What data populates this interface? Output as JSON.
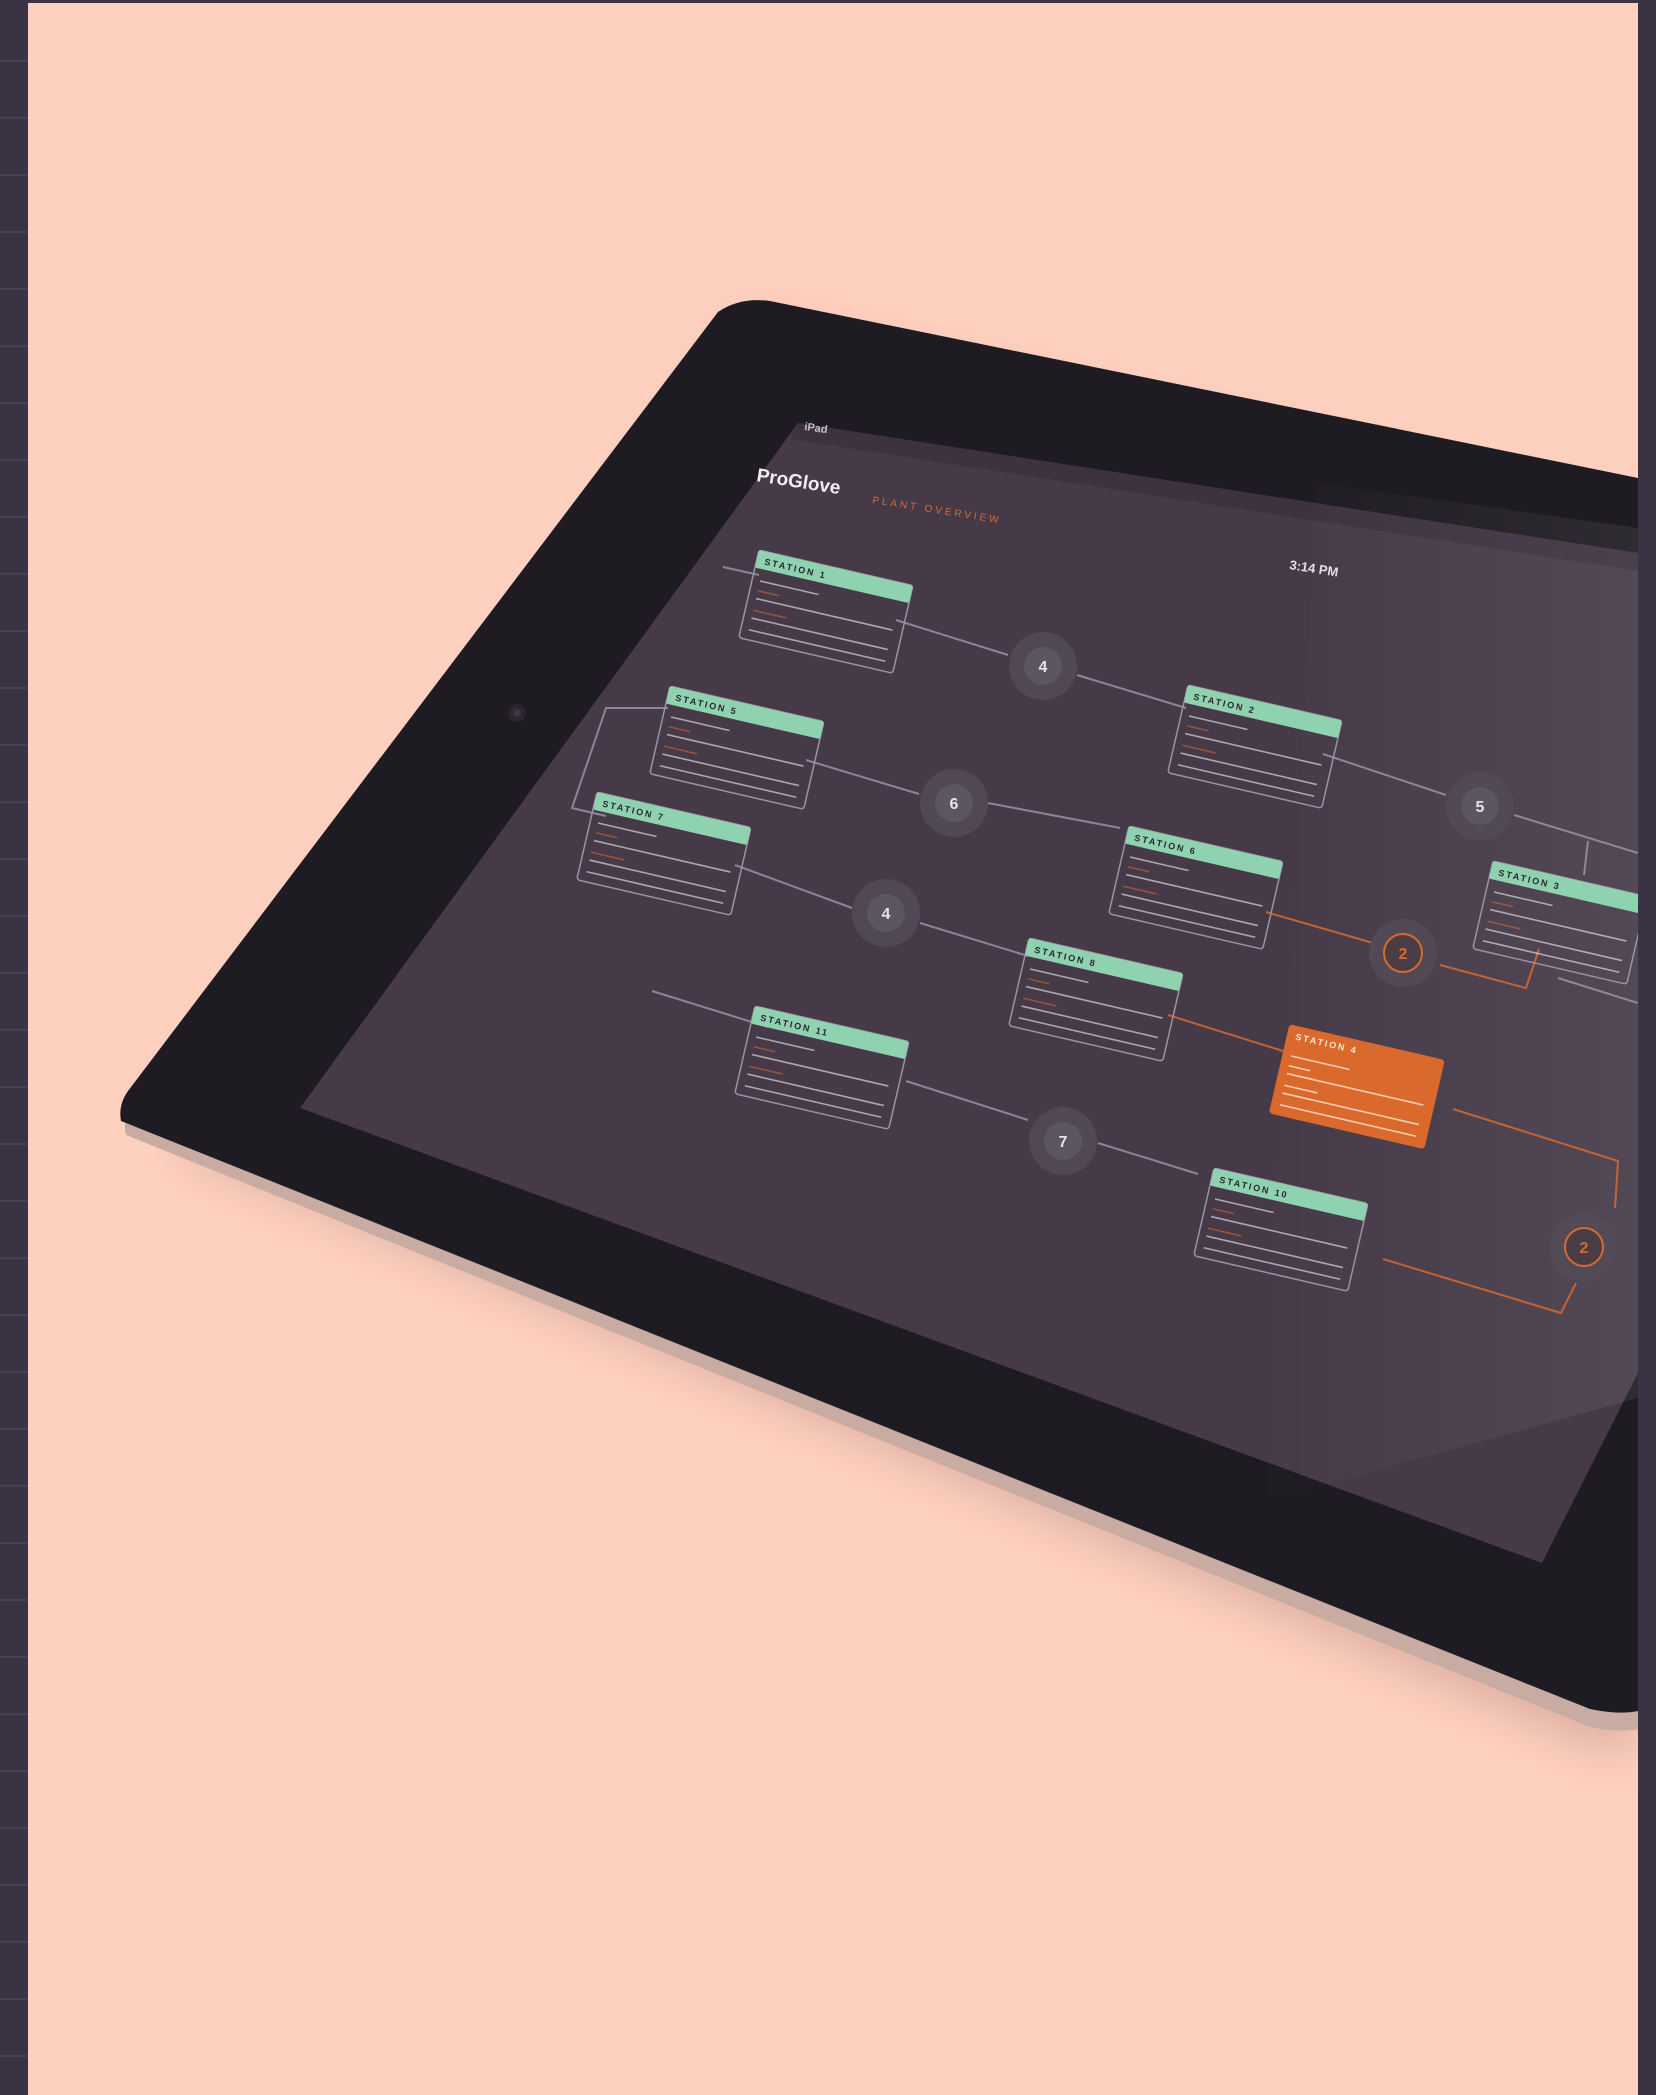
{
  "colors": {
    "background": "#fed0c0",
    "frame": "#3a3344",
    "bezel": "#1f1b22",
    "screen": "#463a49",
    "node_header": "#8fd2b0",
    "node_border": "#9c92a5",
    "accent_orange": "#d9692d",
    "counter_fill": "#5d5660",
    "counter_ring": "#524a56"
  },
  "device": {
    "status_left": "iPad",
    "status_time": "3:14 PM"
  },
  "app": {
    "logo": "ProGlove",
    "nav_label": "PLANT OVERVIEW"
  },
  "stations": [
    {
      "label": "STATION 1",
      "state": "normal"
    },
    {
      "label": "STATION 2",
      "state": "normal"
    },
    {
      "label": "STATION 3",
      "state": "normal"
    },
    {
      "label": "STATION 4",
      "state": "alert"
    },
    {
      "label": "STATION 5",
      "state": "normal"
    },
    {
      "label": "STATION 6",
      "state": "normal"
    },
    {
      "label": "STATION 7",
      "state": "normal"
    },
    {
      "label": "STATION 8",
      "state": "normal"
    },
    {
      "label": "STATION 10",
      "state": "normal"
    },
    {
      "label": "STATION 11",
      "state": "normal"
    }
  ],
  "counters": [
    {
      "value": "4",
      "state": "normal"
    },
    {
      "value": "5",
      "state": "normal"
    },
    {
      "value": "6",
      "state": "normal"
    },
    {
      "value": "4",
      "state": "normal"
    },
    {
      "value": "2",
      "state": "alert"
    },
    {
      "value": "7",
      "state": "normal"
    },
    {
      "value": "2",
      "state": "alert"
    }
  ]
}
